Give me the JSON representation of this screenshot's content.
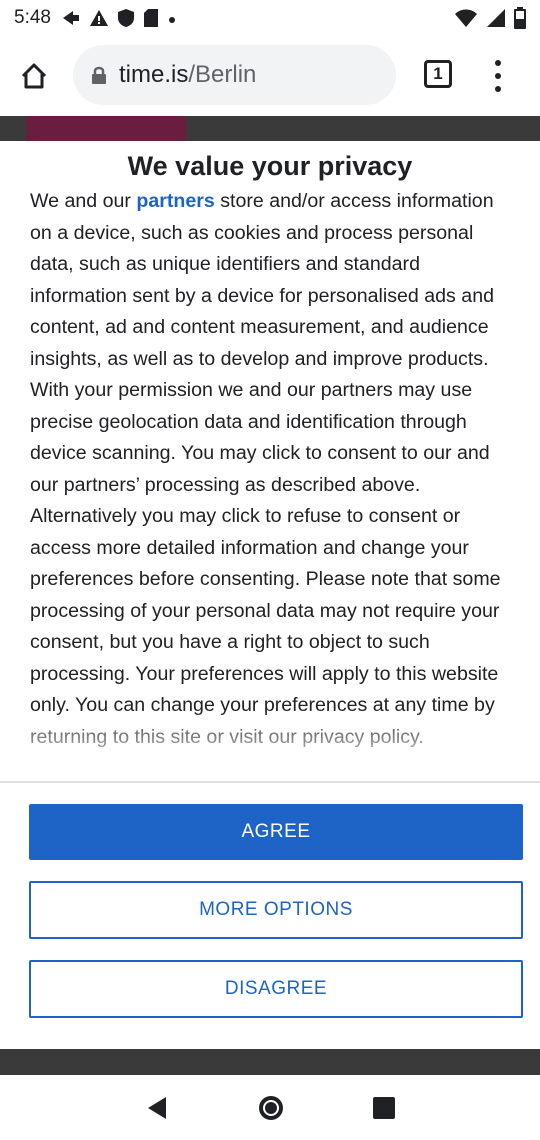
{
  "status_bar": {
    "time": "5:48"
  },
  "browser": {
    "url_host": "time.is",
    "url_path": "/Berlin",
    "tab_count": "1"
  },
  "dialog": {
    "title": "We value your privacy",
    "body_prefix": "We and our ",
    "partners_link": "partners",
    "body_rest": " store and/or access information on a device, such as cookies and process personal data, such as unique identifiers and standard information sent by a device for personalised ads and content, ad and content measurement, and audience insights, as well as to develop and improve products. With your permission we and our partners may use precise geolocation data and identification through device scanning. You may click to consent to our and our partners’ processing as described above. Alternatively you may click to refuse to consent or access more detailed information and change your preferences before consenting. Please note that some processing of your personal data may not require your consent, but you have a right to object to such processing. Your preferences will apply to this website only. You can change your preferences at any time by returning to this site or visit our privacy policy.",
    "agree_label": "AGREE",
    "more_options_label": "MORE OPTIONS",
    "disagree_label": "DISAGREE"
  },
  "colors": {
    "accent": "#1e63c6",
    "page_behind": "#3a3a3a",
    "behind_strip": "#6b1d3f"
  }
}
